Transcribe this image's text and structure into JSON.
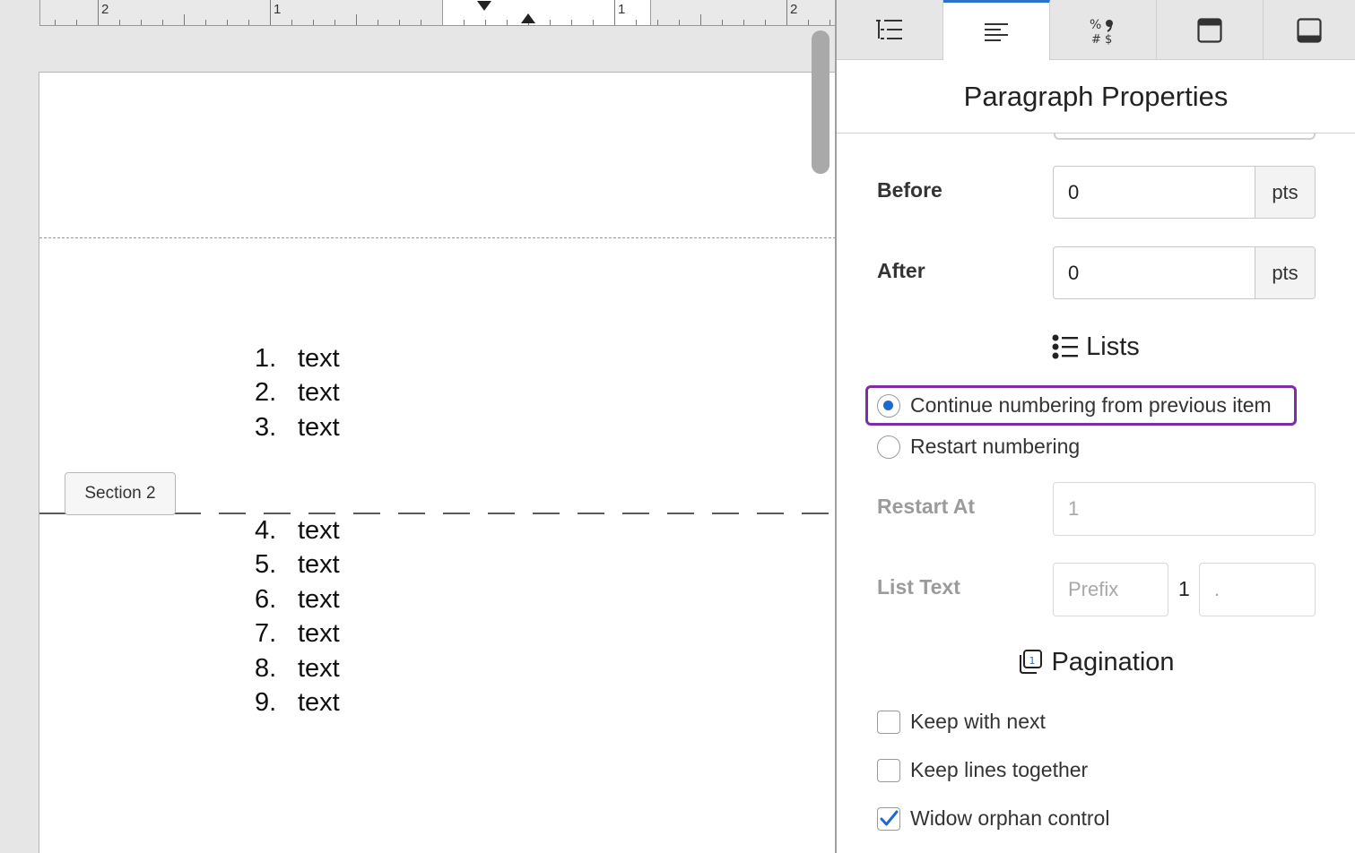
{
  "ruler": {
    "numbers": [
      "2",
      "1",
      "1",
      "2"
    ]
  },
  "document": {
    "list_before": [
      {
        "num": "1.",
        "text": "text"
      },
      {
        "num": "2.",
        "text": "text"
      },
      {
        "num": "3.",
        "text": "text"
      }
    ],
    "section_tab_label": "Section 2",
    "list_after": [
      {
        "num": "4.",
        "text": "text"
      },
      {
        "num": "5.",
        "text": "text"
      },
      {
        "num": "6.",
        "text": "text"
      },
      {
        "num": "7.",
        "text": "text"
      },
      {
        "num": "8.",
        "text": "text"
      },
      {
        "num": "9.",
        "text": "text"
      }
    ]
  },
  "sidebar": {
    "tabs": [
      {
        "icon": "list-settings-icon",
        "active": false
      },
      {
        "icon": "paragraph-icon",
        "active": true
      },
      {
        "icon": "number-format-icon",
        "active": false,
        "glyphs": "% ❟ # $"
      },
      {
        "icon": "header-icon",
        "active": false
      },
      {
        "icon": "footer-icon",
        "active": false
      }
    ],
    "title": "Paragraph Properties",
    "spacing": {
      "before_label": "Before",
      "before_value": "0",
      "after_label": "After",
      "after_value": "0",
      "unit": "pts"
    },
    "lists": {
      "heading": "Lists",
      "continue_label": "Continue numbering from previous item",
      "restart_label": "Restart numbering",
      "restart_at_label": "Restart At",
      "restart_at_value": "1",
      "list_text_label": "List Text",
      "prefix_placeholder": "Prefix",
      "number_text": "1",
      "suffix_value": "."
    },
    "pagination": {
      "heading": "Pagination",
      "keep_with_next": "Keep with next",
      "keep_lines_together": "Keep lines together",
      "widow_orphan": "Widow orphan control"
    },
    "colors": {
      "accent": "#2a72c8",
      "focus": "#7b2ea6",
      "radio_on": "#1c6bd0"
    }
  }
}
